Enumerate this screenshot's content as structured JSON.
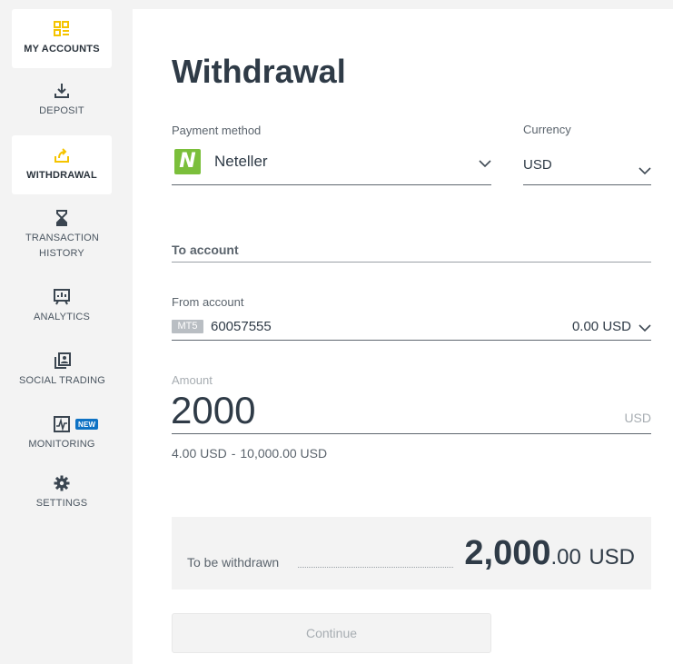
{
  "sidebar": {
    "items": [
      {
        "label": "MY ACCOUNTS",
        "icon": "accounts-icon"
      },
      {
        "label": "DEPOSIT",
        "icon": "download-icon"
      },
      {
        "label": "WITHDRAWAL",
        "icon": "upload-share-icon",
        "active": true
      },
      {
        "label": "TRANSACTION HISTORY",
        "icon": "hourglass-icon"
      },
      {
        "label": "ANALYTICS",
        "icon": "presentation-chart-icon"
      },
      {
        "label": "SOCIAL TRADING",
        "icon": "copy-user-icon"
      },
      {
        "label": "MONITORING",
        "icon": "monitor-pulse-icon",
        "badge": "NEW"
      },
      {
        "label": "SETTINGS",
        "icon": "gear-icon"
      }
    ]
  },
  "page": {
    "title": "Withdrawal"
  },
  "payment": {
    "label": "Payment method",
    "logo_letter": "N",
    "value": "Neteller"
  },
  "currency": {
    "label": "Currency",
    "value": "USD"
  },
  "to_account": {
    "label": "To account"
  },
  "from_account": {
    "label": "From account",
    "platform": "MT5",
    "number": "60057555",
    "balance": "0.00 USD"
  },
  "amount": {
    "label": "Amount",
    "value": "2000",
    "currency": "USD",
    "min": "4.00 USD",
    "separator": "-",
    "max": "10,000.00 USD"
  },
  "summary": {
    "label": "To be withdrawn",
    "amount_main": "2,000",
    "amount_decimals": ".00",
    "currency": "USD"
  },
  "actions": {
    "continue_label": "Continue"
  },
  "colors": {
    "accent_yellow": "#f5c400",
    "badge_blue": "#0e72c4",
    "neteller_green": "#7bbf3b",
    "text_dark": "#2f3b47"
  }
}
